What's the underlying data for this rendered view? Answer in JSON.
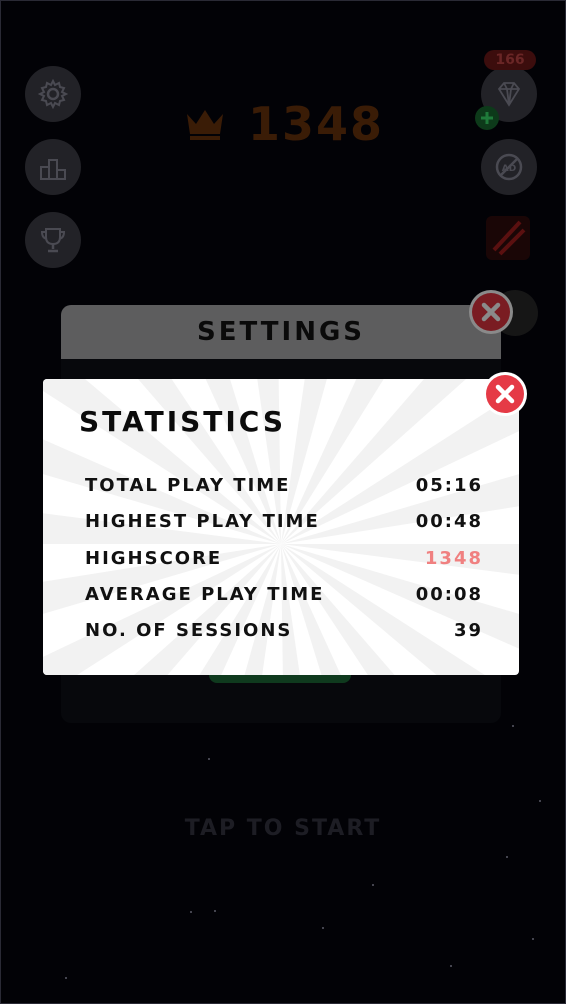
{
  "hud": {
    "score": "1348",
    "gem_count": "166"
  },
  "settings": {
    "title": "SETTINGS"
  },
  "statistics": {
    "title": "STATISTICS",
    "rows": [
      {
        "label": "TOTAL PLAY TIME",
        "value": "05:16"
      },
      {
        "label": "HIGHEST PLAY TIME",
        "value": "00:48"
      },
      {
        "label": "HIGHSCORE",
        "value": "1348"
      },
      {
        "label": "AVERAGE PLAY TIME",
        "value": "00:08"
      },
      {
        "label": "NO. OF SESSIONS",
        "value": "39"
      }
    ]
  },
  "tap_to_start": "TAP TO START",
  "colors": {
    "close_red": "#e53a46",
    "highscore": "#f08080",
    "score_orange": "#3a1c06"
  }
}
